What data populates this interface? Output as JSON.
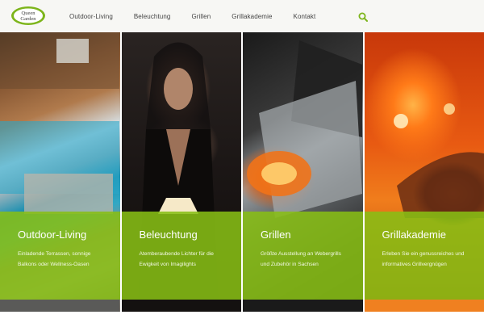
{
  "brand": {
    "logo_text_line1": "Queen",
    "logo_text_line2": "Garden",
    "logo_color": "#7db51b"
  },
  "nav": {
    "items": [
      "Outdoor-Living",
      "Beleuchtung",
      "Grillen",
      "Grillakademie",
      "Kontakt"
    ],
    "search_icon": "search-icon"
  },
  "colors": {
    "accent": "#87be14",
    "header_bg": "#f7f7f4",
    "nav_text": "#444444"
  },
  "panels": [
    {
      "title": "Outdoor-Living",
      "text": "Einladende Terrassen, sonnige Balkons oder Wellness-Oasen"
    },
    {
      "title": "Beleuchtung",
      "text": "Atemberaubende Lichter für die Ewigkeit von Imagilights"
    },
    {
      "title": "Grillen",
      "text": "Größte Ausstellung an Webergrills und Zubehör in Sachsen"
    },
    {
      "title": "Grillakademie",
      "text": "Erleben Sie ein genussreiches und informatives Grillvergnügen"
    }
  ]
}
